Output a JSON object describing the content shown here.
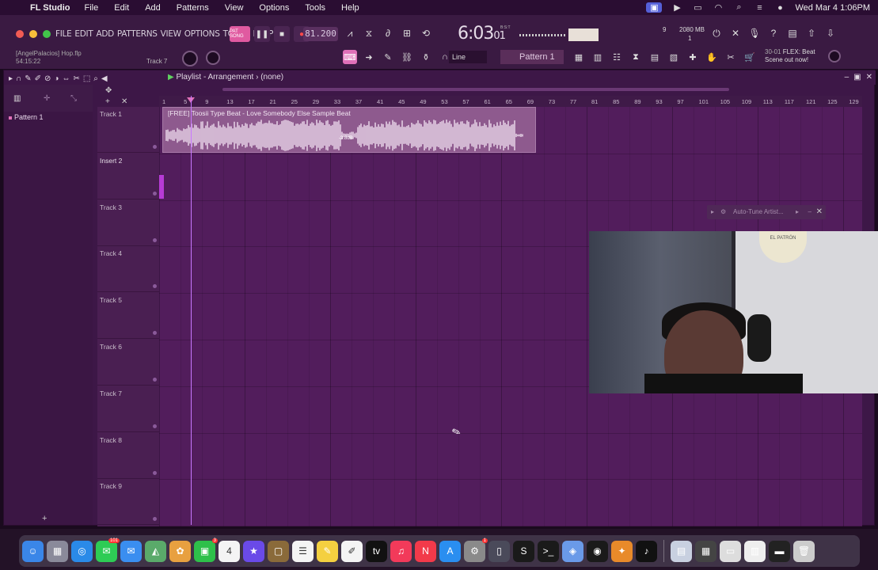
{
  "menubar": {
    "app": "FL Studio",
    "items": [
      "File",
      "Edit",
      "Add",
      "Patterns",
      "View",
      "Options",
      "Tools",
      "Help"
    ],
    "clock": "Wed Mar 4  1:06PM"
  },
  "fl": {
    "menu": [
      "FILE",
      "EDIT",
      "ADD",
      "PATTERNS",
      "VIEW",
      "OPTIONS",
      "TOOLS",
      "HELP"
    ],
    "project_user": "[AngelPalacios] Hop.flp",
    "project_time": "54:15:22",
    "track_hint": "Track 7",
    "pat_song_label": "PAT SONG",
    "tempo": "81.200",
    "time_main": "6:03",
    "time_sub": "01",
    "time_tag": "B:S:T",
    "cpu_val1": "9",
    "cpu_mem": "2080 MB",
    "cpu_val2": "1",
    "snap": "Line",
    "pattern_select": "Pattern 1",
    "hint_index": "30-01",
    "hint_title": "FLEX: Beat",
    "hint_sub": "Scene out now!"
  },
  "playlist": {
    "title": "Playlist - Arrangement",
    "sep": "›",
    "arrangement": "(none)",
    "pattern_item": "Pattern 1",
    "clip_label": "[FREE] Toosii Type Beat - Love Somebody Else  Sample Beat",
    "clip_db": "-3.8dB",
    "ruler": [
      "1",
      "5",
      "9",
      "13",
      "17",
      "21",
      "25",
      "29",
      "33",
      "37",
      "41",
      "45",
      "49",
      "53",
      "57",
      "61",
      "65",
      "69",
      "73",
      "77",
      "81",
      "85",
      "89",
      "93",
      "97",
      "101",
      "105",
      "109",
      "113",
      "117",
      "121",
      "125",
      "129"
    ],
    "tracks": [
      "Track 1",
      "Insert 2",
      "Track 3",
      "Track 4",
      "Track 5",
      "Track 6",
      "Track 7",
      "Track 8",
      "Track 9"
    ]
  },
  "plugin": {
    "name": "Auto-Tune Artist..."
  },
  "webcam": {
    "hat_text": "EL PATRÓN"
  },
  "dock": {
    "apps": [
      {
        "name": "Finder",
        "color": "#3a86e8",
        "glyph": "☺"
      },
      {
        "name": "Launchpad",
        "color": "#8a8a9a",
        "glyph": "▦"
      },
      {
        "name": "Safari",
        "color": "#2a8ae8",
        "glyph": "◎"
      },
      {
        "name": "Messages",
        "color": "#2ecc55",
        "glyph": "✉",
        "badge": "101"
      },
      {
        "name": "Mail",
        "color": "#3a8ef0",
        "glyph": "✉"
      },
      {
        "name": "Maps",
        "color": "#5aaa6a",
        "glyph": "◭"
      },
      {
        "name": "Photos",
        "color": "#e8a040",
        "glyph": "✿"
      },
      {
        "name": "FaceTime",
        "color": "#2ec04a",
        "glyph": "▣",
        "badge": "3"
      },
      {
        "name": "Calendar",
        "color": "#f4f4f4",
        "glyph": "4",
        "dark": true
      },
      {
        "name": "iMovie",
        "color": "#6a4ae8",
        "glyph": "★"
      },
      {
        "name": "Folder",
        "color": "#8a6a3a",
        "glyph": "▢"
      },
      {
        "name": "Reminders",
        "color": "#f4f4f4",
        "glyph": "☰",
        "dark": true
      },
      {
        "name": "Notes",
        "color": "#f4d040",
        "glyph": "✎"
      },
      {
        "name": "Freeform",
        "color": "#f4f4f4",
        "glyph": "✐",
        "dark": true
      },
      {
        "name": "Apple TV",
        "color": "#111",
        "glyph": "tv"
      },
      {
        "name": "Music",
        "color": "#f23a5a",
        "glyph": "♫"
      },
      {
        "name": "News",
        "color": "#f23a4a",
        "glyph": "N"
      },
      {
        "name": "App Store",
        "color": "#2a8ef0",
        "glyph": "A"
      },
      {
        "name": "System Settings",
        "color": "#8a8a8a",
        "glyph": "⚙",
        "badge": "1"
      },
      {
        "name": "iPhone Mirroring",
        "color": "#4a4a5a",
        "glyph": "▯"
      },
      {
        "name": "Scrivener",
        "color": "#1a1a1a",
        "glyph": "S"
      },
      {
        "name": "Terminal",
        "color": "#1a1a1a",
        "glyph": ">_"
      },
      {
        "name": "Preview",
        "color": "#6a9ae8",
        "glyph": "◈"
      },
      {
        "name": "Spotify",
        "color": "#1a1a1a",
        "glyph": "◉"
      },
      {
        "name": "FL Studio",
        "color": "#e88a2a",
        "glyph": "✦"
      },
      {
        "name": "TikTok",
        "color": "#111",
        "glyph": "♪"
      }
    ],
    "right": [
      {
        "name": "Downloads",
        "color": "#c8d0e0",
        "glyph": "▤"
      },
      {
        "name": "Screenshot 1",
        "color": "#444",
        "glyph": "▦"
      },
      {
        "name": "Screenshot 2",
        "color": "#ddd",
        "glyph": "▭"
      },
      {
        "name": "Screenshot 3",
        "color": "#eee",
        "glyph": "▥"
      },
      {
        "name": "Screenshot 4",
        "color": "#222",
        "glyph": "▬"
      },
      {
        "name": "Trash",
        "color": "#ccc",
        "glyph": "🗑"
      }
    ]
  },
  "colors": {
    "accent": "#e070b8",
    "playlist_bg": "#521d5c",
    "clip": "#8e5a8e"
  }
}
